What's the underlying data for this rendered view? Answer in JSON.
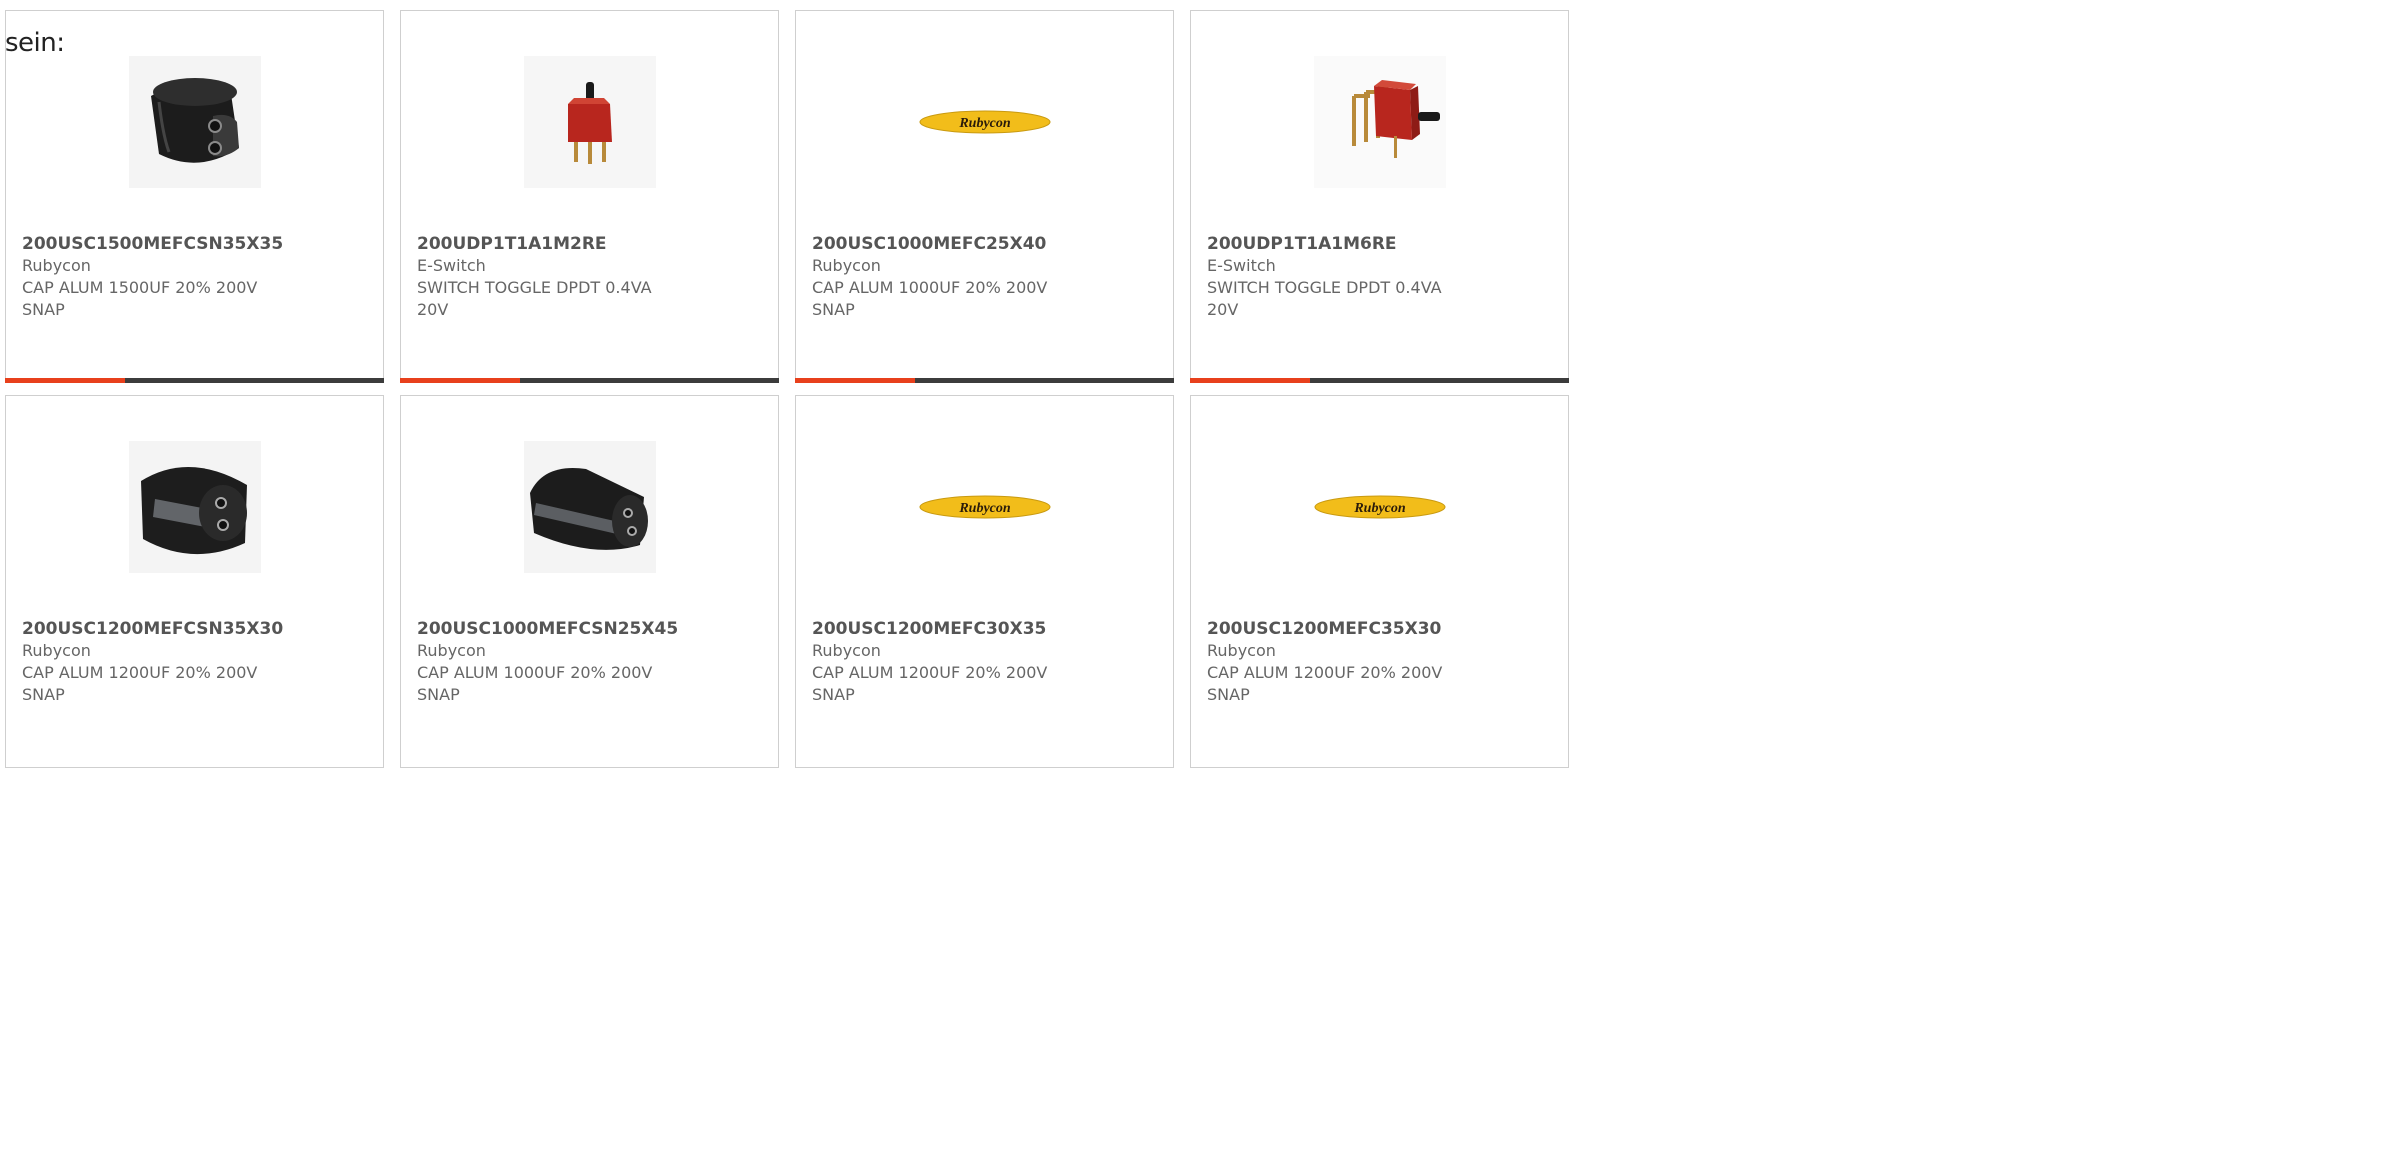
{
  "intro_text": "sein:",
  "colors": {
    "accent": "#e8401c",
    "bar": "#3c3c3c",
    "card_border": "#cfcfcf"
  },
  "products": [
    {
      "part": "200USC1500MEFCSN35X35",
      "maker": "Rubycon",
      "desc": "CAP ALUM 1500UF 20% 200V SNAP",
      "image": "capacitor-short-icon",
      "has_bar": true
    },
    {
      "part": "200UDP1T1A1M2RE",
      "maker": "E-Switch",
      "desc": "SWITCH TOGGLE DPDT 0.4VA 20V",
      "image": "toggle-switch-vertical-icon",
      "has_bar": true
    },
    {
      "part": "200USC1000MEFC25X40",
      "maker": "Rubycon",
      "desc": "CAP ALUM 1000UF 20% 200V SNAP",
      "image": "rubycon-logo",
      "logo_text": "Rubycon",
      "has_bar": true
    },
    {
      "part": "200UDP1T1A1M6RE",
      "maker": "E-Switch",
      "desc": "SWITCH TOGGLE DPDT 0.4VA 20V",
      "image": "toggle-switch-right-angle-icon",
      "has_bar": true
    },
    {
      "part": "200USC1200MEFCSN35X30",
      "maker": "Rubycon",
      "desc": "CAP ALUM 1200UF 20% 200V SNAP",
      "image": "capacitor-wide-icon",
      "has_bar": false
    },
    {
      "part": "200USC1000MEFCSN25X45",
      "maker": "Rubycon",
      "desc": "CAP ALUM 1000UF 20% 200V SNAP",
      "image": "capacitor-long-icon",
      "has_bar": false
    },
    {
      "part": "200USC1200MEFC30X35",
      "maker": "Rubycon",
      "desc": "CAP ALUM 1200UF 20% 200V SNAP",
      "image": "rubycon-logo",
      "logo_text": "Rubycon",
      "has_bar": false
    },
    {
      "part": "200USC1200MEFC35X30",
      "maker": "Rubycon",
      "desc": "CAP ALUM 1200UF 20% 200V SNAP",
      "image": "rubycon-logo",
      "logo_text": "Rubycon",
      "has_bar": false
    }
  ]
}
